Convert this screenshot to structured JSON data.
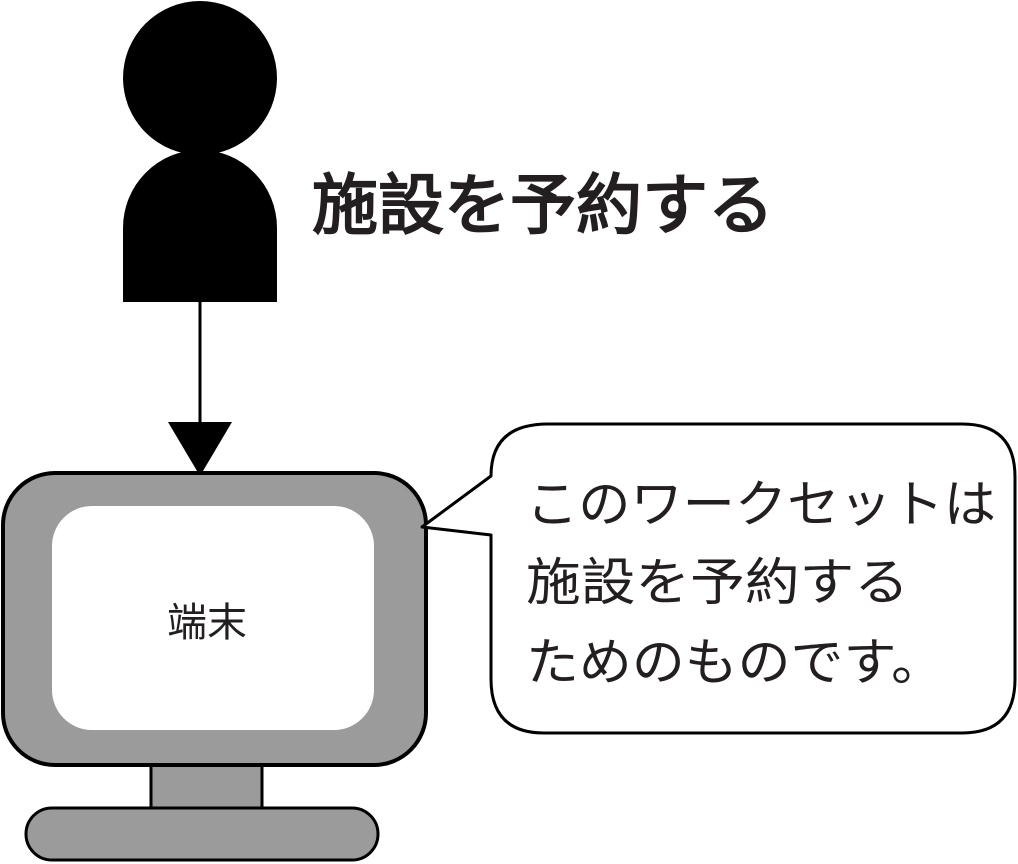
{
  "title": "施設を予約する",
  "terminal": {
    "label": "端末"
  },
  "callout": {
    "lines": [
      "このワークセットは",
      "施設を予約する",
      "ためのものです。"
    ]
  },
  "colors": {
    "ink": "#000000",
    "monitor_gray": "#9b9b9b",
    "screen": "#ffffff"
  }
}
